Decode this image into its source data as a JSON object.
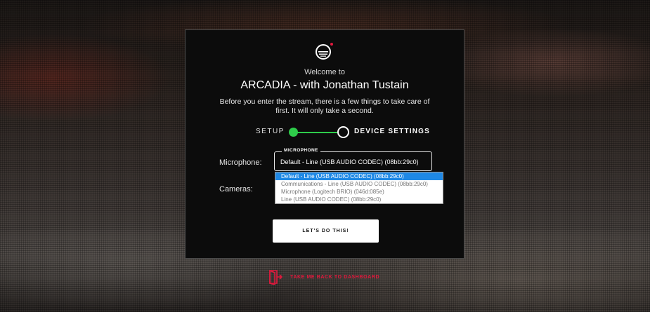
{
  "brand": {
    "accent": "#e0193d",
    "success": "#2ecc4a",
    "select_blue": "#1e88e5"
  },
  "card": {
    "logo_icon": "sunset-logo-icon",
    "welcome": "Welcome to",
    "title": "ARCADIA - with Jonathan Tustain",
    "description": "Before you enter the stream, there is a few things to take care of first. It will only take a second."
  },
  "stepper": {
    "steps": [
      {
        "label": "SETUP",
        "state": "done"
      },
      {
        "label": "DEVICE SETTINGS",
        "state": "current"
      }
    ]
  },
  "form": {
    "microphone_label": "Microphone:",
    "cameras_label": "Cameras:",
    "microphone": {
      "legend": "MICROPHONE",
      "value": "Default - Line (USB AUDIO CODEC) (08bb:29c0)",
      "options": [
        "Default - Line (USB AUDIO CODEC) (08bb:29c0)",
        "Communications - Line (USB AUDIO CODEC) (08bb:29c0)",
        "Microphone (Logitech BRIO) (046d:085e)",
        "Line (USB AUDIO CODEC) (08bb:29c0)"
      ],
      "selected_index": 0
    }
  },
  "actions": {
    "continue_label": "LET'S DO THIS!",
    "back_label": "TAKE ME BACK TO DASHBOARD",
    "back_icon": "exit-door-icon"
  }
}
